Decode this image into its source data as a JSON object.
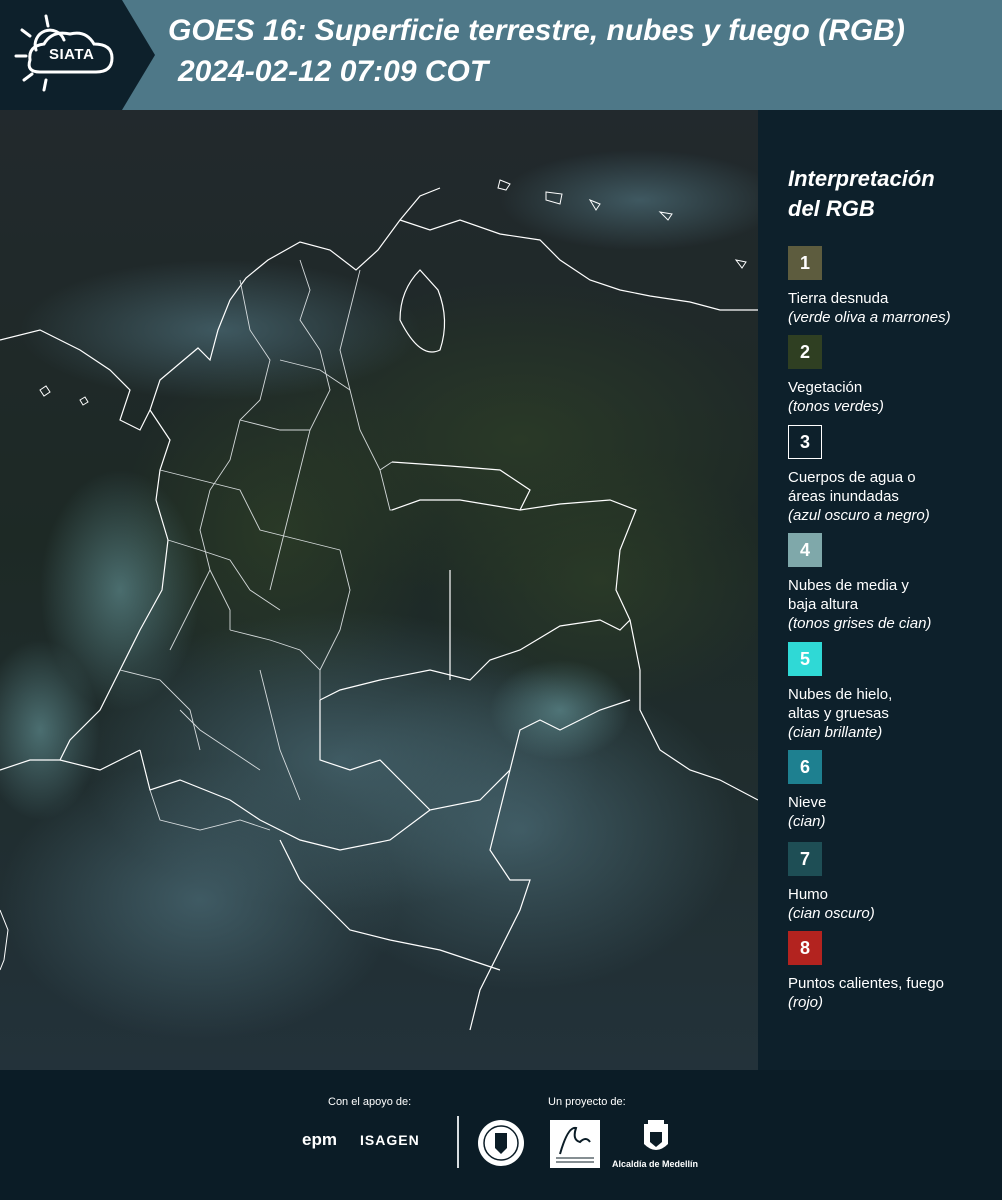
{
  "header": {
    "logo_text": "SIATA",
    "title_line1": "GOES 16: Superficie terrestre, nubes y fuego (RGB)",
    "title_line2": "2024-02-12 07:09 COT"
  },
  "legend": {
    "title_line1": "Interpretación",
    "title_line2": "del RGB",
    "items": [
      {
        "number": "1",
        "label": "Tierra desnuda",
        "desc": "(verde oliva a marrones)",
        "color": "#5d5c3e"
      },
      {
        "number": "2",
        "label": "Vegetación",
        "desc": "(tonos verdes)",
        "color": "#2f3f22"
      },
      {
        "number": "3",
        "label": "Cuerpos de agua o áreas inundadas",
        "desc": "(azul oscuro a negro)",
        "color": "#0d202b"
      },
      {
        "number": "4",
        "label": "Nubes de media y baja altura",
        "desc": "(tonos grises de cian)",
        "color": "#7fa8aa"
      },
      {
        "number": "5",
        "label": "Nubes de hielo, altas y gruesas",
        "desc": "(cian brillante)",
        "color": "#2fd9d6"
      },
      {
        "number": "6",
        "label": "Nieve",
        "desc": "(cian)",
        "color": "#1e8090"
      },
      {
        "number": "7",
        "label": "Humo",
        "desc": "(cian oscuro)",
        "color": "#1e4e55"
      },
      {
        "number": "8",
        "label": "Puntos calientes, fuego",
        "desc": "(rojo)",
        "color": "#b3231f"
      }
    ]
  },
  "footer": {
    "support_label": "Con el apoyo de:",
    "project_label": "Un proyecto de:",
    "sponsor_1": "epm",
    "sponsor_2": "ISAGEN",
    "partner_1": "Área Metropolitana Valle de Aburrá",
    "partner_2": "Alcaldía de Medellín"
  }
}
